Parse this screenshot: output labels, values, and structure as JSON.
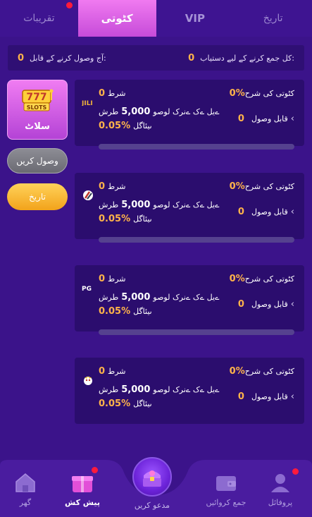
{
  "tabs": [
    {
      "label": "تقریبات",
      "dot": true
    },
    {
      "label": "کٹوتی",
      "active": true
    },
    {
      "label": "VIP"
    },
    {
      "label": "تاریخ"
    }
  ],
  "summary": {
    "today_label": "آج وصول کرنے کے قابل:",
    "today_value": "0",
    "total_label": "کل جمع کرنے کے لیے دستیاب:",
    "total_value": "0"
  },
  "side": {
    "slots_label": "سلاٹ",
    "slots_logo_text": "777 SLOTS",
    "collect_label": "وصول کریں",
    "history_label": "تاریخ"
  },
  "cards": [
    {
      "provider_icon": "jili-icon",
      "provider_text": "JILI",
      "shart_label": "شرط",
      "shart_value": "0",
      "rate_label": "کٹوتی کی شرح",
      "rate_value": "0%",
      "bet_prefix": "طرش",
      "bet_value": "5,000",
      "bet_suffix": "ےیل ےک ےنرک لوصو",
      "pct_value": "0.05%",
      "pct_label": "ںیئاگل",
      "claim_label": "قابل وصول",
      "claim_value": "0"
    },
    {
      "provider_icon": "stripe-icon",
      "provider_text": "",
      "shart_label": "شرط",
      "shart_value": "0",
      "rate_label": "کٹوتی کی شرح",
      "rate_value": "0%",
      "bet_prefix": "طرش",
      "bet_value": "5,000",
      "bet_suffix": "ےیل ےک ےنرک لوصو",
      "pct_value": "0.05%",
      "pct_label": "ںیئاگل",
      "claim_label": "قابل وصول",
      "claim_value": "0"
    },
    {
      "provider_icon": "pg-icon",
      "provider_text": "PG",
      "shart_label": "شرط",
      "shart_value": "0",
      "rate_label": "کٹوتی کی شرح",
      "rate_value": "0%",
      "bet_prefix": "طرش",
      "bet_value": "5,000",
      "bet_suffix": "ےیل ےک ےنرک لوصو",
      "pct_value": "0.05%",
      "pct_label": "ںیئاگل",
      "claim_label": "قابل وصول",
      "claim_value": "0"
    },
    {
      "provider_icon": "face-icon",
      "provider_text": "",
      "shart_label": "شرط",
      "shart_value": "0",
      "rate_label": "کٹوتی کی شرح",
      "rate_value": "0%",
      "bet_prefix": "طرش",
      "bet_value": "5,000",
      "bet_suffix": "ےیل ےک ےنرک لوصو",
      "pct_value": "0.05%",
      "pct_label": "ںیئاگل",
      "claim_label": "قابل وصول",
      "claim_value": "0"
    }
  ],
  "nav": {
    "home": "گھر",
    "offer": "پیش کش",
    "invite": "مدعو کریں",
    "deposit": "جمع کروائیں",
    "profile": "پروفائل"
  },
  "colors": {
    "accent": "#ffb34a",
    "bg": "#3b138a",
    "card": "#2b0d6e",
    "tab_active": "#e06ee8"
  }
}
